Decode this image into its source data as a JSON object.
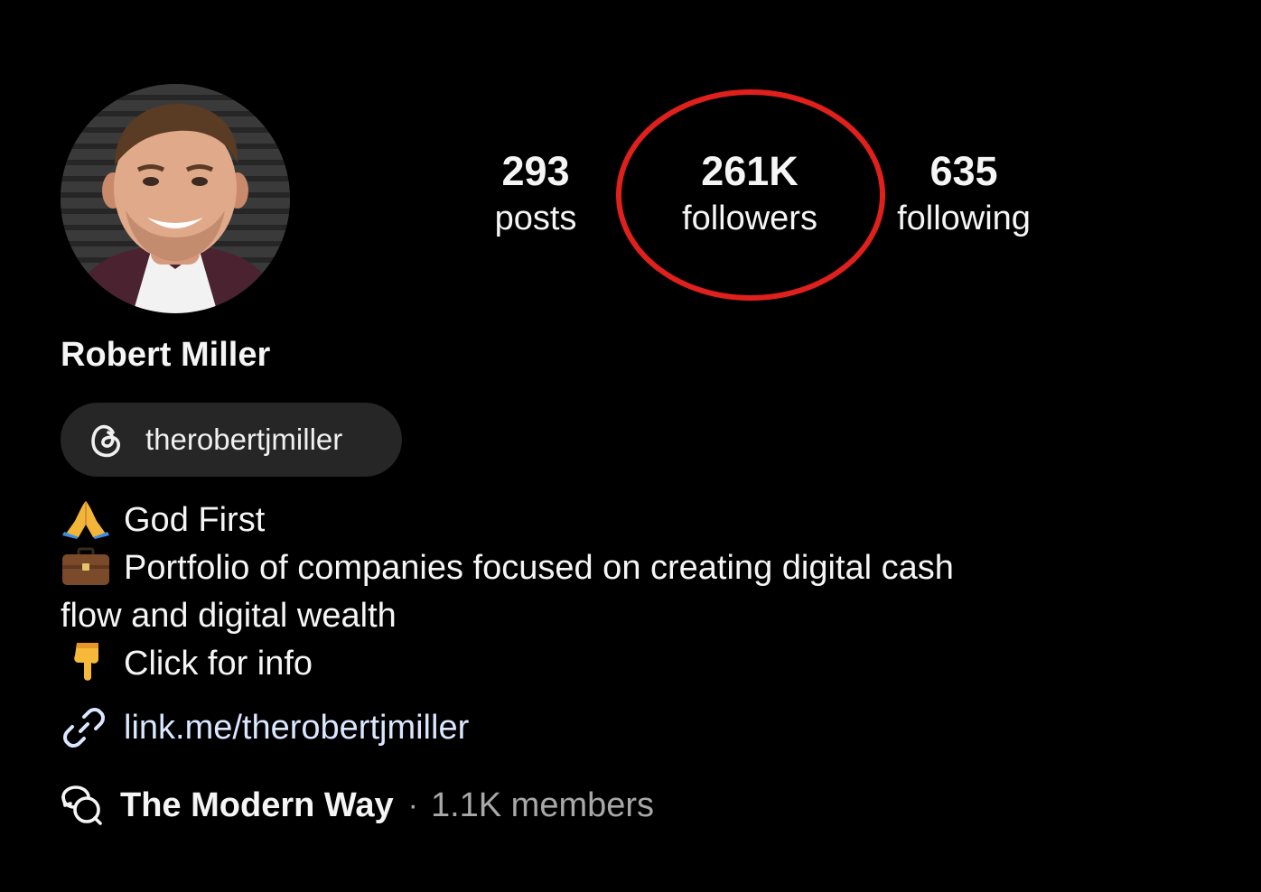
{
  "profile": {
    "name": "Robert Miller",
    "avatar": "profile-photo"
  },
  "stats": {
    "posts": {
      "value": "293",
      "label": "posts"
    },
    "followers": {
      "value": "261K",
      "label": "followers"
    },
    "following": {
      "value": "635",
      "label": "following"
    }
  },
  "threads": {
    "icon": "threads-icon",
    "handle": "therobertjmiller"
  },
  "bio": {
    "line1": {
      "emoji": "folded-hands-emoji",
      "text": "God First"
    },
    "line2": {
      "emoji": "briefcase-emoji",
      "text": "Portfolio of companies focused on creating digital cash"
    },
    "line3": {
      "text": "flow and digital wealth"
    },
    "line4": {
      "emoji": "pointing-down-emoji",
      "text": "Click for info"
    }
  },
  "link": {
    "icon": "link-icon",
    "url": "link.me/therobertjmiller"
  },
  "community": {
    "icon": "community-chat-icon",
    "name": "The Modern Way",
    "separator": "·",
    "members": "1.1K members"
  },
  "annotation": {
    "color": "#e0201c",
    "target": "followers"
  }
}
